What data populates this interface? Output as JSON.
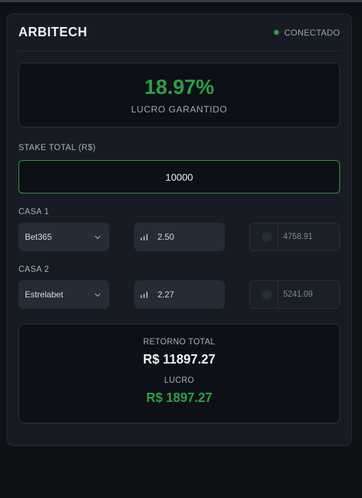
{
  "app": {
    "title": "ARBITECH",
    "status": "CONECTADO"
  },
  "profit": {
    "percent": "18.97%",
    "label": "LUCRO GARANTIDO"
  },
  "stake": {
    "label": "STAKE TOTAL (R$)",
    "value": "10000"
  },
  "casas": [
    {
      "label": "CASA 1",
      "bookmaker": "Bet365",
      "odds": "2.50",
      "stake": "4758.91"
    },
    {
      "label": "CASA 2",
      "bookmaker": "Estrelabet",
      "odds": "2.27",
      "stake": "5241.09"
    }
  ],
  "result": {
    "total_label": "RETORNO TOTAL",
    "total_value": "R$ 11897.27",
    "profit_label": "LUCRO",
    "profit_value": "R$ 1897.27"
  },
  "colors": {
    "accent": "#2ea043",
    "background": "#0e1116",
    "card": "#171c24"
  }
}
